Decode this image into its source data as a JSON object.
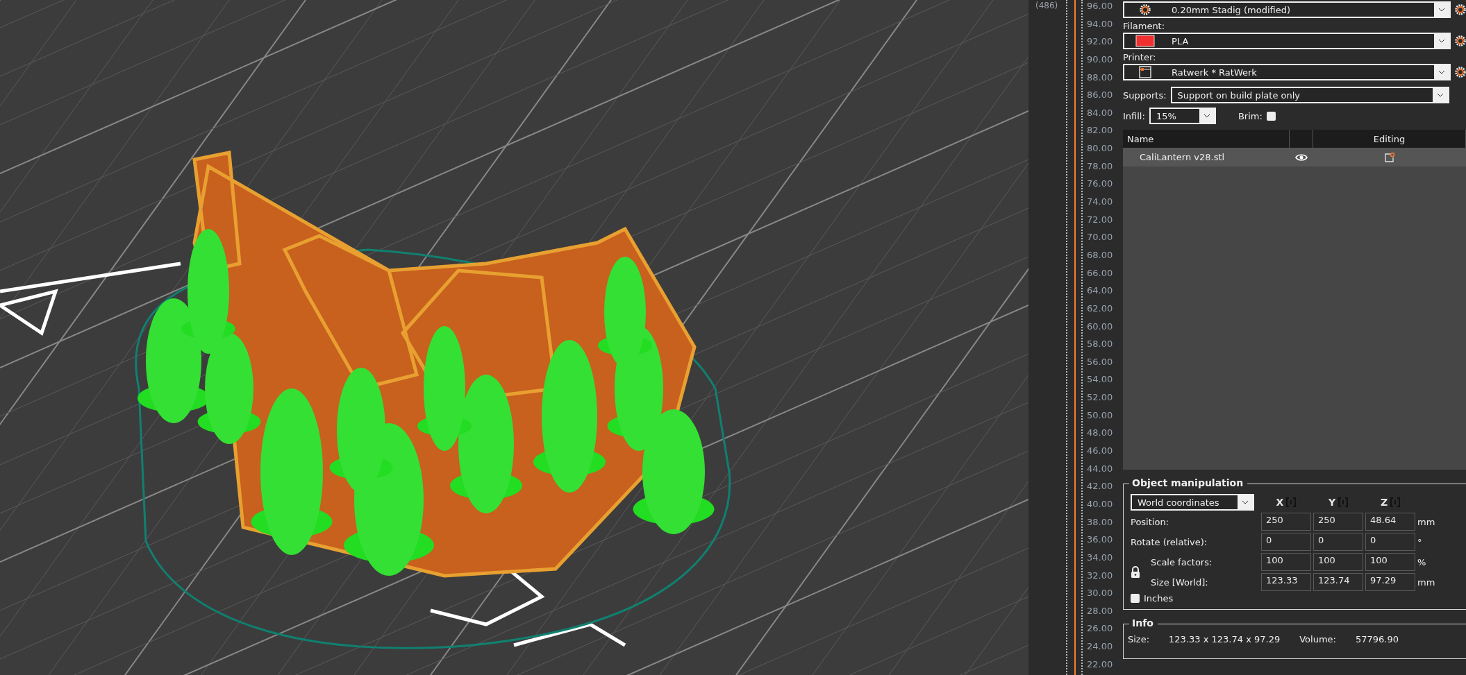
{
  "layer_slider": {
    "layer_count": "(486)",
    "heights": [
      "96.00",
      "94.00",
      "92.00",
      "90.00",
      "88.00",
      "86.00",
      "84.00",
      "82.00",
      "80.00",
      "78.00",
      "76.00",
      "74.00",
      "72.00",
      "70.00",
      "68.00",
      "66.00",
      "64.00",
      "62.00",
      "60.00",
      "58.00",
      "56.00",
      "54.00",
      "52.00",
      "50.00",
      "48.00",
      "46.00",
      "44.00",
      "42.00",
      "40.00",
      "38.00",
      "36.00",
      "34.00",
      "32.00",
      "30.00",
      "28.00",
      "26.00",
      "24.00",
      "22.00"
    ]
  },
  "print_settings": {
    "profile": "0.20mm Stadig (modified)",
    "filament_label": "Filament:",
    "filament": "PLA",
    "printer_label": "Printer:",
    "printer": "Ratwerk * RatWerk",
    "supports_label": "Supports:",
    "supports": "Support on build plate only",
    "infill_label": "Infill:",
    "infill": "15%",
    "brim_label": "Brim:",
    "brim_checked": false
  },
  "object_list": {
    "name_header": "Name",
    "editing_header": "Editing",
    "rows": [
      {
        "name": "CaliLantern v28.stl",
        "selected": true
      }
    ]
  },
  "object_manipulation": {
    "title": "Object manipulation",
    "coordinates": "World coordinates",
    "axes": [
      "X",
      "Y",
      "Z"
    ],
    "rows": [
      {
        "kind": "plain",
        "label": "Position:",
        "values": [
          "250",
          "250",
          "48.64"
        ],
        "unit": "mm"
      },
      {
        "kind": "plain",
        "label": "Rotate (relative):",
        "values": [
          "0",
          "0",
          "0"
        ],
        "unit": "°"
      },
      {
        "kind": "locked",
        "label": "Scale factors:",
        "values": [
          "100",
          "100",
          "100"
        ],
        "unit": "%"
      },
      {
        "kind": "locked",
        "label": "Size [World]:",
        "values": [
          "123.33",
          "123.74",
          "97.29"
        ],
        "unit": "mm"
      }
    ],
    "inches_label": "Inches",
    "inches_checked": false
  },
  "info": {
    "title": "Info",
    "size_label": "Size:",
    "size": "123.33 x 123.74 x 97.29",
    "volume_label": "Volume:",
    "volume": "57796.90"
  }
}
